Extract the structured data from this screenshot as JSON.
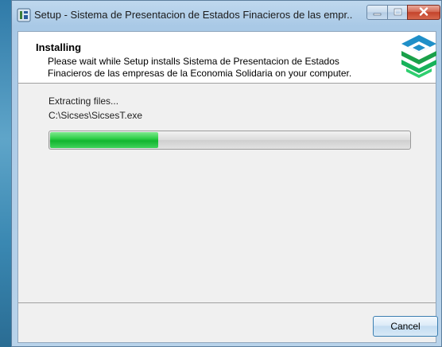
{
  "window": {
    "title": "Setup - Sistema de Presentacion de Estados Finacieros  de las empr...",
    "controls": {
      "minimize_icon": "minimize-icon",
      "maximize_icon": "maximize-icon",
      "close_icon": "close-icon"
    }
  },
  "header": {
    "heading": "Installing",
    "description": "Please wait while Setup installs Sistema de Presentacion de Estados Finacieros de las empresas de la Economia Solidaria on your computer.",
    "logo_icon": "installer-logo-icon"
  },
  "main": {
    "status": "Extracting files...",
    "current_file": "C:\\Sicses\\SicsesT.exe",
    "progress": 0.3
  },
  "footer": {
    "cancel_label": "Cancel"
  },
  "colors": {
    "progress_fill": "#2fcf49",
    "close_button": "#c4432b",
    "title_bar": "#a9c9e6"
  }
}
